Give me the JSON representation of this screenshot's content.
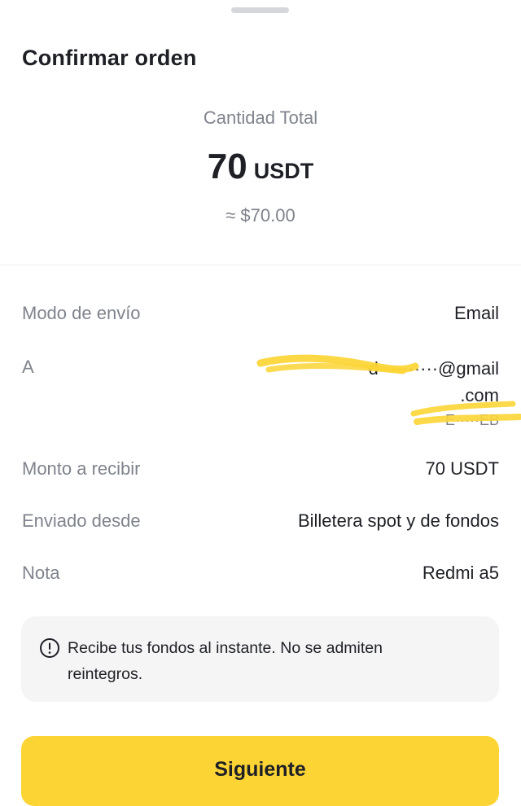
{
  "header": {
    "title": "Confirmar orden"
  },
  "summary": {
    "total_label": "Cantidad Total",
    "amount": "70",
    "currency": "USDT",
    "fiat_estimate": "≈ $70.00"
  },
  "details": {
    "send_mode_label": "Modo de envío",
    "send_mode_value": "Email",
    "recipient_label": "A",
    "recipient_email_line1": "d··········@gmail",
    "recipient_email_line2": ".com",
    "recipient_extra": "E·····EB",
    "receive_amount_label": "Monto a recibir",
    "receive_amount_value": "70 USDT",
    "sent_from_label": "Enviado desde",
    "sent_from_value": "Billetera spot y de fondos",
    "note_label": "Nota",
    "note_value": "Redmi a5"
  },
  "notice": {
    "icon": "info-circle-icon",
    "text": "Recibe tus fondos al instante. No se admiten reintegros."
  },
  "actions": {
    "next_label": "Siguiente"
  },
  "colors": {
    "accent": "#fcd535",
    "text_primary": "#1e2026",
    "text_secondary": "#7f838c",
    "notice_bg": "#f5f5f5",
    "redaction": "#fcd535"
  }
}
